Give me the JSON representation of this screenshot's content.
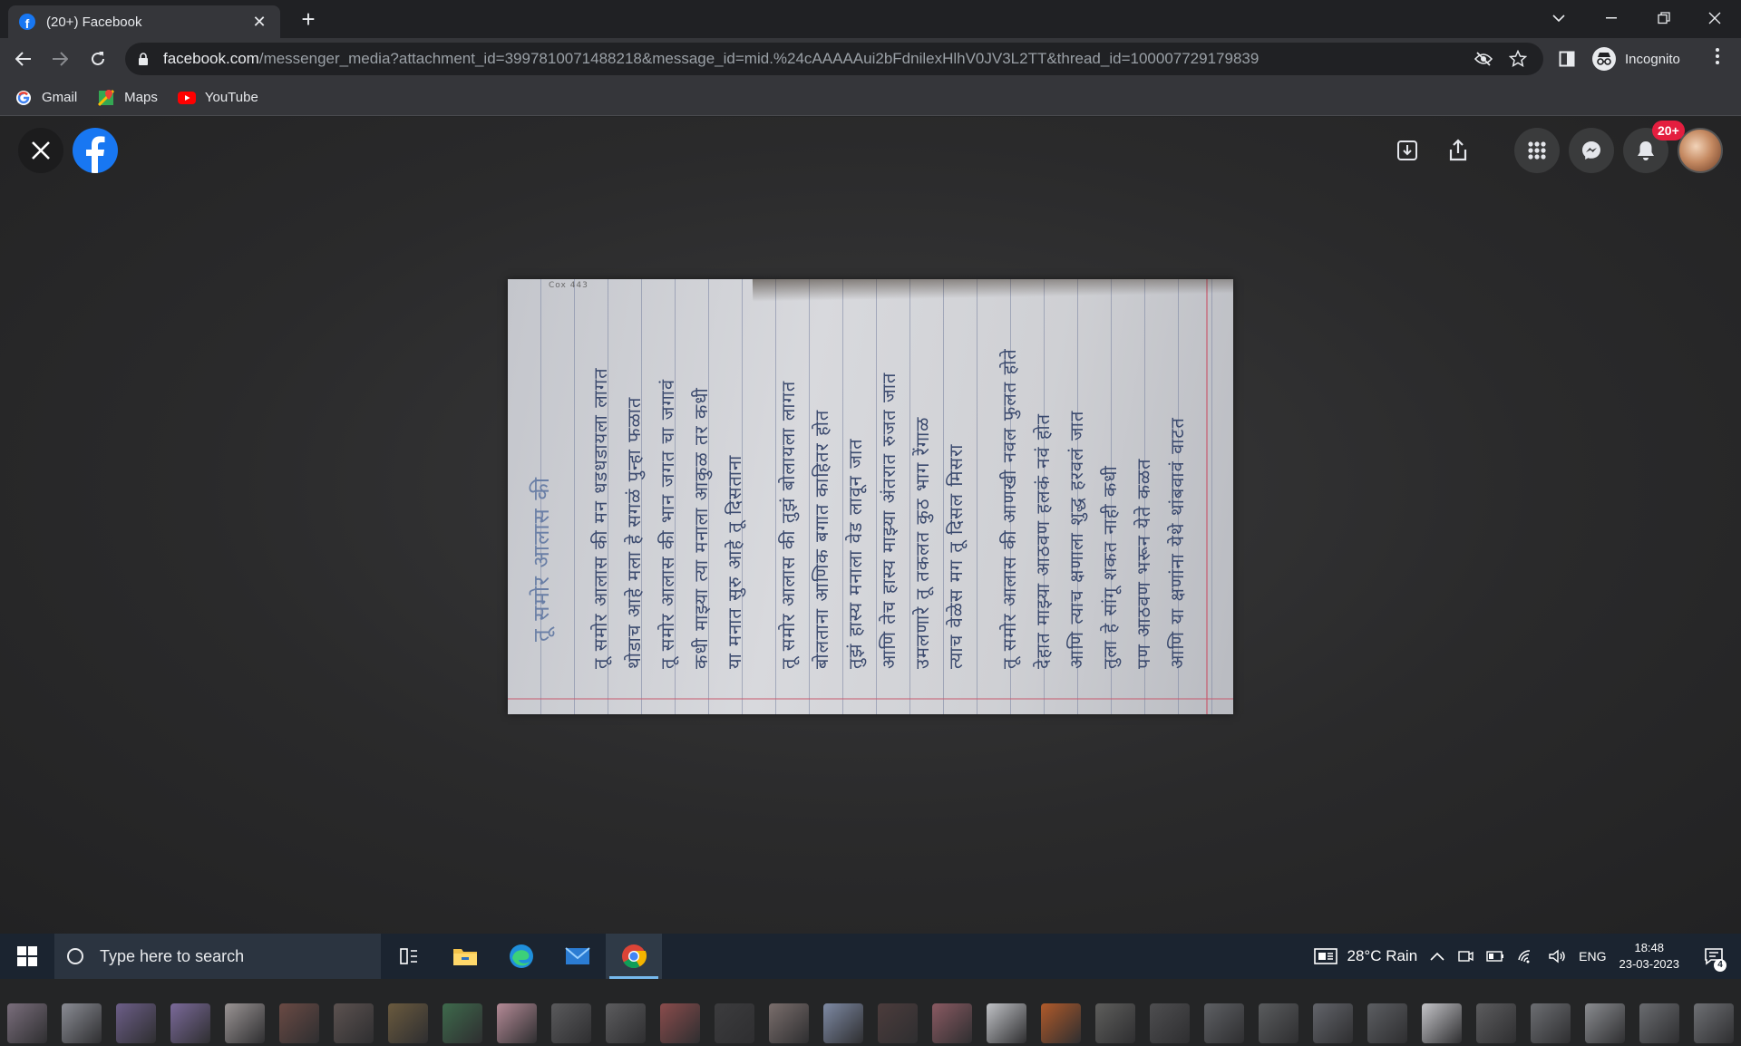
{
  "browser": {
    "tab_title": "(20+) Facebook",
    "tab_close": "✕",
    "new_tab": "+",
    "url_domain": "facebook.com",
    "url_path": "/messenger_media?attachment_id=3997810071488218&message_id=mid.%24cAAAAAui2bFdnilexHlhV0JV3L2TT&thread_id=100007729179839",
    "incognito_label": "Incognito",
    "icons": [
      "back-icon",
      "forward-icon",
      "reload-icon",
      "lock-icon",
      "eye-off-icon",
      "star-icon",
      "sidepanel-icon",
      "incognito-icon",
      "menu-icon"
    ]
  },
  "bookmarks": [
    {
      "label": "Gmail",
      "icon": "google-icon"
    },
    {
      "label": "Maps",
      "icon": "maps-icon"
    },
    {
      "label": "YouTube",
      "icon": "youtube-icon"
    }
  ],
  "viewer": {
    "notification_badge": "20+",
    "icons": [
      "close-icon",
      "facebook-logo",
      "download-icon",
      "share-icon",
      "apps-grid-icon",
      "messenger-icon",
      "bell-icon",
      "avatar"
    ],
    "photo_header_small": "Cox 443",
    "photo_title": "तू समोर आलास की",
    "photo_lines": [
      "तू समोर आलास की मन धडधडायला लागत",
      "थोडाच आहे मला हे सगळं पुन्हा फळात",
      "तू समोर आलास की भान जगत चा जगावं",
      "कधी माझ्या त्या मनाला आकुळ तर कधी",
      "या मनात सुरु आहे तू दिसताना",
      "तू समोर आलास की तुझं बोलायला लागत",
      "बोलताना आणिक बगात काहितर होत",
      "तुझं हास्य मनाला वेड लावून जात",
      "आणि तेच हास्य माझ्या अंतरात रुजत जात",
      "उमलणारे तू तकलत कुठ भाग रेंगाळ",
      "त्याच वेळेस मग तू दिसल मिसरा",
      "तू समोर आलास की आणखी नवल फुलत होते",
      "देहात माझ्या आठवण हलकं नवं होत",
      "आणि त्याच क्षणाला शुद्ध हरवलं जात",
      "तुला हे सांगू शकत नाही कधी",
      "पण आठवण भरून येते कळत",
      "आणि या क्षणांना येथे थांबवावं वाटत"
    ]
  },
  "thumbnails": [
    "#7a6e7c",
    "#8a8c94",
    "#6c5e88",
    "#7b6a9a",
    "#9a9494",
    "#6a4a44",
    "#5c5250",
    "#6a5a3e",
    "#3e6a4c",
    "#b48a96",
    "#5a5a5c",
    "#5c5c5e",
    "#8a4c4c",
    "#3c3c3e",
    "#7a6e6c",
    "#7e8aa4",
    "#4c3c3c",
    "#8a5a62",
    "#c0c2c6",
    "#b05a2a",
    "#5e5e5c",
    "#4e4e50",
    "#5e6064",
    "#5a5c5e",
    "#62646a",
    "#5c5e62",
    "#c4c4c8",
    "#5c5c5e",
    "#6c6e72",
    "#8a8c90",
    "#6a6c70",
    "#6e7074"
  ],
  "taskbar": {
    "search_placeholder": "Type here to search",
    "weather": "28°C  Rain",
    "language": "ENG",
    "time": "18:48",
    "date": "23-03-2023",
    "notification_count": "4",
    "icons": [
      "windows-start-icon",
      "search-icon",
      "task-view-icon",
      "file-explorer-icon",
      "edge-icon",
      "mail-icon",
      "chrome-icon",
      "weather-icon",
      "chevron-up-icon",
      "meet-icon",
      "battery-icon",
      "wifi-icon",
      "volume-icon",
      "notification-icon"
    ]
  }
}
